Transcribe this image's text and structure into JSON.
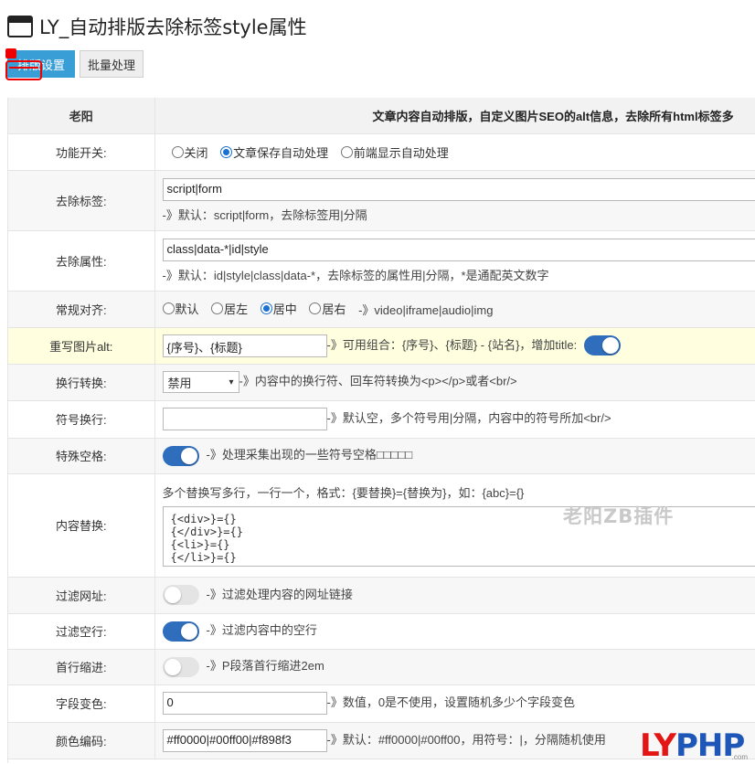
{
  "app": {
    "title": "LY_自动排版去除标签style属性"
  },
  "tabs": [
    {
      "label": "排版设置",
      "active": true
    },
    {
      "label": "批量处理",
      "active": false
    }
  ],
  "table_head": {
    "author": "老阳",
    "description": "文章内容自动排版，自定义图片SEO的alt信息，去除所有html标签多"
  },
  "rows": {
    "func_switch": {
      "label": "功能开关:",
      "options": [
        "关闭",
        "文章保存自动处理",
        "前端显示自动处理"
      ],
      "selected": "文章保存自动处理"
    },
    "remove_tags": {
      "label": "去除标签:",
      "value": "script|form",
      "hint": "-》默认：script|form，去除标签用|分隔"
    },
    "remove_attrs": {
      "label": "去除属性:",
      "value": "class|data-*|id|style",
      "hint": "-》默认：id|style|class|data-*，去除标签的属性用|分隔，*是通配英文数字"
    },
    "align": {
      "label": "常规对齐:",
      "options": [
        "默认",
        "居左",
        "居中",
        "居右"
      ],
      "selected": "居中",
      "hint": "-》video|iframe|audio|img"
    },
    "img_alt": {
      "label": "重写图片alt:",
      "value": "{序号}、{标题}",
      "hint": "-》可用组合：{序号}、{标题} - {站名}，增加title:",
      "toggle_on": true
    },
    "newline": {
      "label": "换行转换:",
      "value": "禁用",
      "hint": "-》内容中的换行符、回车符转换为<p></p>或者<br/>"
    },
    "symbol_newline": {
      "label": "符号换行:",
      "value": "",
      "hint": "-》默认空，多个符号用|分隔，内容中的符号所加<br/>"
    },
    "special_space": {
      "label": "特殊空格:",
      "toggle_on": true,
      "hint": "-》处理采集出现的一些符号空格□□□□□"
    },
    "content_replace": {
      "label": "内容替换:",
      "hint": "多个替换写多行，一行一个，格式：{要替换}={替换为}，如：{abc}={}",
      "lines": [
        "{<div>}={}",
        "{</div>}={}",
        "{<li>}={}",
        "{</li>}={}"
      ]
    },
    "filter_url": {
      "label": "过滤网址:",
      "toggle_on": false,
      "hint": "-》过滤处理内容的网址链接"
    },
    "filter_empty": {
      "label": "过滤空行:",
      "toggle_on": true,
      "hint": "-》过滤内容中的空行"
    },
    "indent": {
      "label": "首行缩进:",
      "toggle_on": false,
      "hint": "-》P段落首行缩进2em"
    },
    "field_color": {
      "label": "字段变色:",
      "value": "0",
      "hint": "-》数值，0是不使用，设置随机多少个字段变色"
    },
    "color_code": {
      "label": "颜色编码:",
      "value": "#ff0000|#00ff00|#f898f3",
      "hint": "-》默认：#ff0000|#00ff00，用符号：|，分隔随机使用"
    }
  },
  "watermark": "老阳ZB插件",
  "logo": {
    "part1": "LY",
    "part2": "PHP",
    "sub": ".com"
  },
  "colors": {
    "accent": "#3a9ed6",
    "toggle_on": "#2f6dbd",
    "highlight_row": "#ffffe0",
    "marker": "#ee0000"
  }
}
